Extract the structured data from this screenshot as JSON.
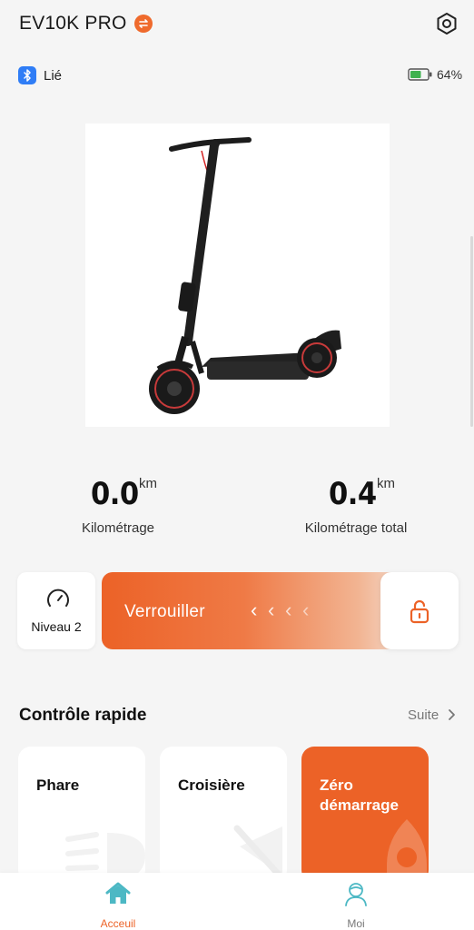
{
  "header": {
    "title": "EV10K PRO",
    "switch_icon": "swap-icon",
    "settings_icon": "settings-icon"
  },
  "status": {
    "bluetooth_icon": "bluetooth-icon",
    "connection_label": "Lié",
    "battery_icon": "battery-icon",
    "battery_percent": "64%",
    "battery_level": 0.64
  },
  "scooter_image": {
    "alt": "scooter-image"
  },
  "metrics": [
    {
      "value": "0.0",
      "unit": "km",
      "label": "Kilométrage"
    },
    {
      "value": "0.4",
      "unit": "km",
      "label": "Kilométrage total"
    }
  ],
  "speed_level": {
    "icon": "speedometer-icon",
    "label": "Niveau 2"
  },
  "lock": {
    "label": "Verrouiller",
    "chevrons": [
      "‹",
      "‹",
      "‹",
      "‹"
    ],
    "icon": "unlock-icon"
  },
  "quick_control": {
    "title": "Contrôle rapide",
    "more_label": "Suite",
    "cards": [
      {
        "title": "Phare",
        "active": false
      },
      {
        "title": "Croisière",
        "active": false
      },
      {
        "title": "Zéro démarrage",
        "active": true
      }
    ]
  },
  "bottom_nav": [
    {
      "label": "Acceuil",
      "icon": "home-icon",
      "active": true
    },
    {
      "label": "Moi",
      "icon": "profile-icon",
      "active": false
    }
  ],
  "colors": {
    "accent": "#ec6227",
    "bluetooth": "#2f7df6",
    "battery": "#3fb24f",
    "nav_active": "#4cb8c4",
    "background": "#f5f5f5"
  }
}
